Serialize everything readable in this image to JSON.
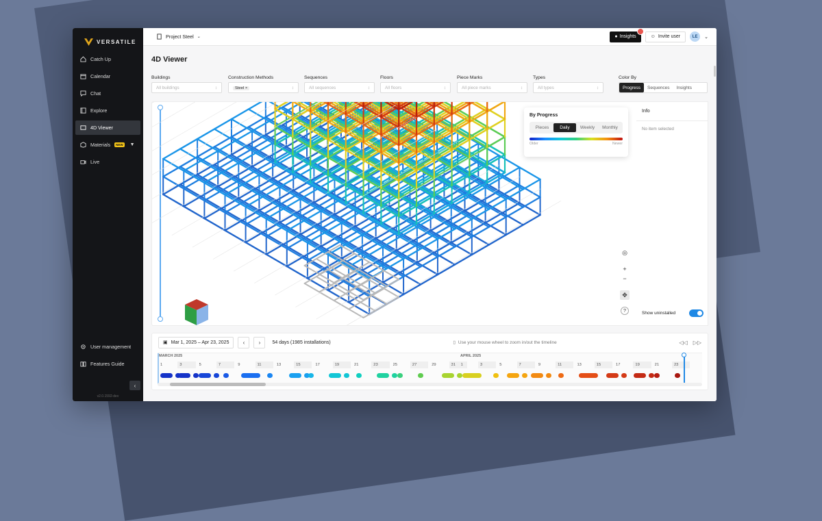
{
  "app": {
    "logo_text": "VERSATILE",
    "version": "v2.0.1592-dev"
  },
  "sidebar": {
    "items": [
      {
        "label": "Catch Up",
        "icon": "home-icon",
        "active": false
      },
      {
        "label": "Calendar",
        "icon": "calendar-icon",
        "active": false
      },
      {
        "label": "Chat",
        "icon": "chat-icon",
        "active": false
      },
      {
        "label": "Explore",
        "icon": "explore-icon",
        "active": false
      },
      {
        "label": "4D Viewer",
        "icon": "cube-icon",
        "active": true
      },
      {
        "label": "Materials",
        "icon": "box-icon",
        "badge": "NEW",
        "active": false
      },
      {
        "label": "Live",
        "icon": "video-icon",
        "active": false
      }
    ],
    "bottom_items": [
      {
        "label": "User management",
        "icon": "gear-icon"
      },
      {
        "label": "Features Guide",
        "icon": "book-icon"
      }
    ]
  },
  "topbar": {
    "project": "Project Steel",
    "insights_label": "Insights",
    "invite_label": "Invite user",
    "avatar_initials": "LE"
  },
  "page": {
    "title": "4D Viewer"
  },
  "filters": {
    "buildings": {
      "label": "Buildings",
      "placeholder": "All buildings"
    },
    "construction_methods": {
      "label": "Construction Methods",
      "value": "Steel"
    },
    "sequences": {
      "label": "Sequences",
      "placeholder": "All sequences"
    },
    "floors": {
      "label": "Floors",
      "placeholder": "All floors"
    },
    "piece_marks": {
      "label": "Piece Marks",
      "placeholder": "All piece marks"
    },
    "types": {
      "label": "Types",
      "placeholder": "All types"
    },
    "color_by": {
      "label": "Color By",
      "options": [
        "Progress",
        "Sequences",
        "Insights"
      ],
      "selected": "Progress"
    }
  },
  "legend": {
    "title": "By Progress",
    "options": [
      "Pieces",
      "Daily",
      "Weekly",
      "Monthly"
    ],
    "selected": "Daily",
    "older_label": "Older",
    "newer_label": "Newer"
  },
  "info_panel": {
    "title": "Info",
    "empty_text": "No item selected",
    "show_uninstalled_label": "Show uninstalled",
    "show_uninstalled": true
  },
  "timeline": {
    "date_range": "Mar 1, 2025 – Apr 23, 2025",
    "summary": "54 days (1985 installations)",
    "hint": "Use your mouse wheel to zoom in/out the timeline",
    "months": [
      "MARCH 2025",
      "APRIL 2025"
    ],
    "march_days": [
      "1",
      "3",
      "5",
      "7",
      "9",
      "11",
      "13",
      "15",
      "17",
      "19",
      "21",
      "23",
      "25",
      "27",
      "29",
      "31"
    ],
    "april_days": [
      "1",
      "3",
      "5",
      "7",
      "9",
      "11",
      "13",
      "15",
      "17",
      "19",
      "21",
      "23"
    ]
  },
  "colors": {
    "accent": "#1e88e5",
    "sidebar_bg": "#141518",
    "dark_button": "#111111"
  }
}
